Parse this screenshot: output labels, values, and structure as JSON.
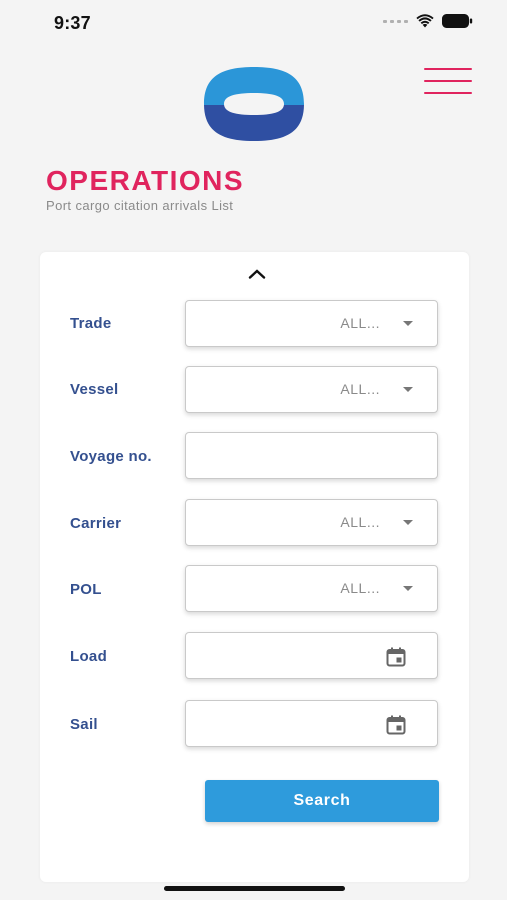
{
  "status_bar": {
    "time": "9:37"
  },
  "header": {
    "title": "OPERATIONS",
    "subtitle": "Port cargo citation arrivals List",
    "brand_color": "#e0245e",
    "logo_colors": {
      "top": "#2b96d8",
      "bottom": "#2f4fa2"
    }
  },
  "filters": {
    "fields": [
      {
        "label": "Trade",
        "type": "select",
        "value": "ALL..."
      },
      {
        "label": "Vessel",
        "type": "select",
        "value": "ALL..."
      },
      {
        "label": "Voyage no.",
        "type": "text",
        "value": ""
      },
      {
        "label": "Carrier",
        "type": "select",
        "value": "ALL..."
      },
      {
        "label": "POL",
        "type": "select",
        "value": "ALL..."
      },
      {
        "label": "Load",
        "type": "date",
        "value": ""
      },
      {
        "label": "Sail",
        "type": "date",
        "value": ""
      }
    ],
    "search_label": "Search",
    "label_color": "#34508f",
    "button_color": "#2e9bdc"
  }
}
